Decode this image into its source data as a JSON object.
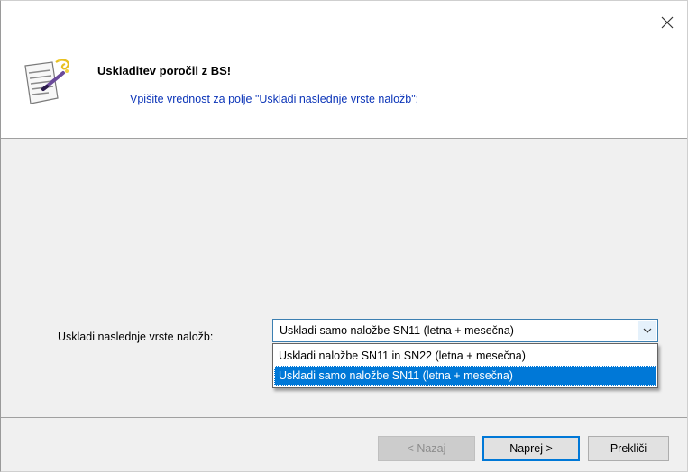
{
  "header": {
    "title": "Uskladitev poročil z BS!",
    "subtitle": "Vpišite vrednost za polje \"Uskladi naslednje vrste naložb\":"
  },
  "form": {
    "field_label": "Uskladi naslednje vrste naložb:",
    "selected_value": "Uskladi samo naložbe SN11 (letna + mesečna)",
    "options": [
      "Uskladi naložbe SN11 in SN22 (letna + mesečna)",
      "Uskladi samo naložbe SN11 (letna + mesečna)"
    ],
    "highlighted_option_index": 1
  },
  "footer": {
    "back_label": "< Nazaj",
    "next_label": "Naprej >",
    "cancel_label": "Prekliči"
  },
  "icons": {
    "close": "close-icon",
    "wizard": "wizard-icon",
    "dropdown": "chevron-down-icon"
  },
  "colors": {
    "subtitle": "#0c35b8",
    "selection": "#0078d7",
    "default_button_border": "#0078d7",
    "panel_background": "#f0f0f0"
  }
}
